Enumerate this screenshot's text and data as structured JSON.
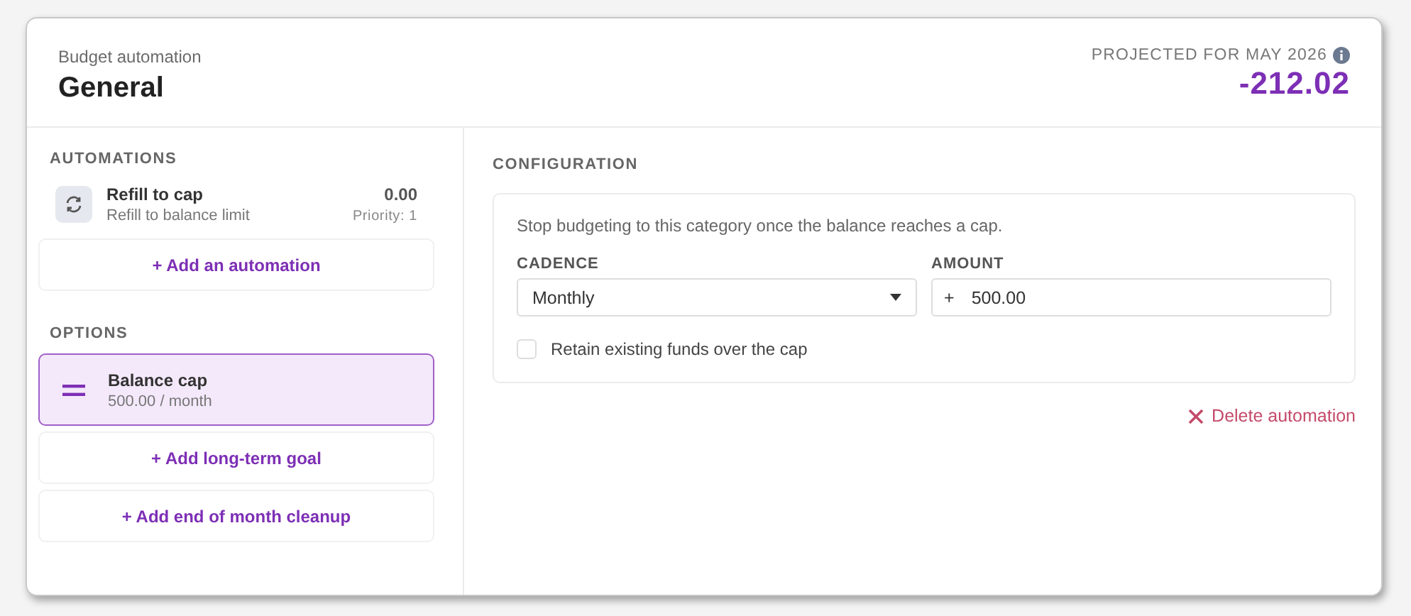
{
  "header": {
    "subtitle": "Budget automation",
    "title": "General",
    "projection_label": "PROJECTED FOR MAY 2026",
    "projection_value": "-212.02"
  },
  "automations": {
    "heading": "AUTOMATIONS",
    "items": [
      {
        "title": "Refill to cap",
        "subtitle": "Refill to balance limit",
        "amount": "0.00",
        "priority": "Priority: 1"
      }
    ],
    "add_button": "+ Add an automation"
  },
  "options": {
    "heading": "OPTIONS",
    "items": [
      {
        "kind": "option",
        "title": "Balance cap",
        "subtitle": "500.00 / month",
        "selected": true
      },
      {
        "kind": "add",
        "label": "+ Add long-term goal"
      },
      {
        "kind": "add",
        "label": "+ Add end of month cleanup"
      }
    ]
  },
  "configuration": {
    "heading": "CONFIGURATION",
    "description": "Stop budgeting to this category once the balance reaches a cap.",
    "cadence": {
      "label": "CADENCE",
      "value": "Monthly"
    },
    "amount": {
      "label": "AMOUNT",
      "prefix": "+",
      "value": "500.00"
    },
    "retain": {
      "label": "Retain existing funds over the cap",
      "checked": false
    },
    "delete_button": "Delete automation"
  }
}
